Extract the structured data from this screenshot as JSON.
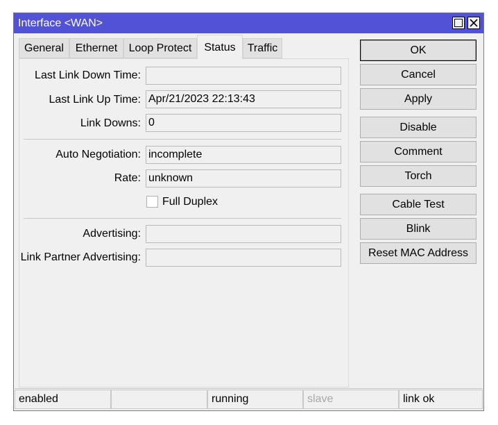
{
  "window": {
    "title": "Interface <WAN>"
  },
  "tabs": [
    {
      "label": "General",
      "active": false
    },
    {
      "label": "Ethernet",
      "active": false
    },
    {
      "label": "Loop Protect",
      "active": false
    },
    {
      "label": "Status",
      "active": true
    },
    {
      "label": "Traffic",
      "active": false
    }
  ],
  "status_form": {
    "last_link_down_time": {
      "label": "Last Link Down Time:",
      "value": ""
    },
    "last_link_up_time": {
      "label": "Last Link Up Time:",
      "value": "Apr/21/2023 22:13:43"
    },
    "link_downs": {
      "label": "Link Downs:",
      "value": "0"
    },
    "auto_negotiation": {
      "label": "Auto Negotiation:",
      "value": "incomplete"
    },
    "rate": {
      "label": "Rate:",
      "value": "unknown"
    },
    "full_duplex": {
      "label": "Full Duplex",
      "checked": false
    },
    "advertising": {
      "label": "Advertising:",
      "value": ""
    },
    "link_partner_advertising": {
      "label": "Link Partner Advertising:",
      "value": ""
    }
  },
  "buttons": {
    "ok": "OK",
    "cancel": "Cancel",
    "apply": "Apply",
    "disable": "Disable",
    "comment": "Comment",
    "torch": "Torch",
    "cable_test": "Cable Test",
    "blink": "Blink",
    "reset_mac": "Reset MAC Address"
  },
  "statusbar": {
    "enabled": "enabled",
    "blank": "",
    "running": "running",
    "slave": "slave",
    "link": "link ok"
  },
  "colors": {
    "titlebar": "#5252d6",
    "window_bg": "#f0f0f0",
    "dim_text": "#a8a8a8"
  }
}
